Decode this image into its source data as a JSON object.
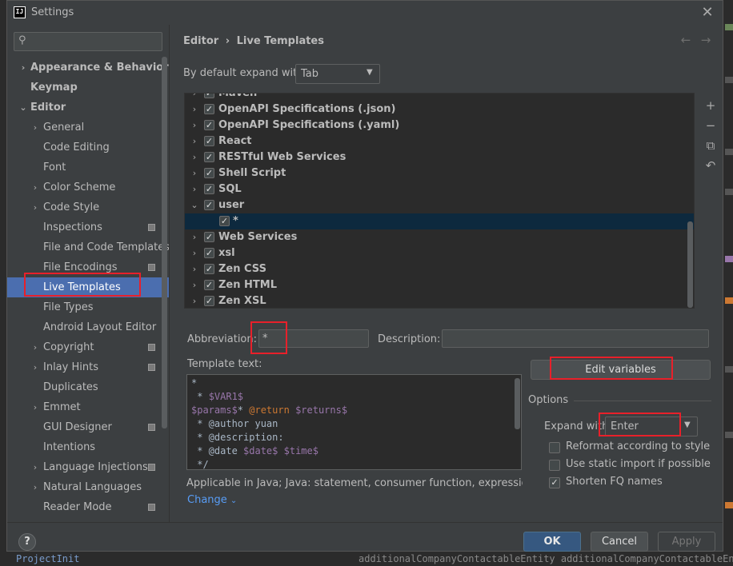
{
  "window": {
    "title": "Settings",
    "logo_text": "IJ"
  },
  "sidebar": {
    "search_placeholder": "",
    "items": [
      {
        "label": "Appearance & Behavior"
      },
      {
        "label": "Keymap"
      },
      {
        "label": "Editor"
      },
      {
        "label": "General"
      },
      {
        "label": "Code Editing"
      },
      {
        "label": "Font"
      },
      {
        "label": "Color Scheme"
      },
      {
        "label": "Code Style"
      },
      {
        "label": "Inspections"
      },
      {
        "label": "File and Code Templates"
      },
      {
        "label": "File Encodings"
      },
      {
        "label": "Live Templates"
      },
      {
        "label": "File Types"
      },
      {
        "label": "Android Layout Editor"
      },
      {
        "label": "Copyright"
      },
      {
        "label": "Inlay Hints"
      },
      {
        "label": "Duplicates"
      },
      {
        "label": "Emmet"
      },
      {
        "label": "GUI Designer"
      },
      {
        "label": "Intentions"
      },
      {
        "label": "Language Injections"
      },
      {
        "label": "Natural Languages"
      },
      {
        "label": "Reader Mode"
      }
    ]
  },
  "breadcrumb": {
    "parent": "Editor",
    "separator": "›",
    "current": "Live Templates"
  },
  "expand": {
    "label": "By default expand with",
    "value": "Tab"
  },
  "template_groups": [
    {
      "label": "Maven"
    },
    {
      "label": "OpenAPI Specifications (.json)"
    },
    {
      "label": "OpenAPI Specifications (.yaml)"
    },
    {
      "label": "React"
    },
    {
      "label": "RESTful Web Services"
    },
    {
      "label": "Shell Script"
    },
    {
      "label": "SQL"
    },
    {
      "label": "user"
    },
    {
      "label": "*"
    },
    {
      "label": "Web Services"
    },
    {
      "label": "xsl"
    },
    {
      "label": "Zen CSS"
    },
    {
      "label": "Zen HTML"
    },
    {
      "label": "Zen XSL"
    }
  ],
  "editor": {
    "abbreviation_label": "Abbreviation:",
    "abbreviation_value": "*",
    "description_label": "Description:",
    "description_value": "",
    "template_text_label": "Template text:",
    "template_lines": [
      "*",
      " * $VAR1$",
      "$params$* @return $returns$",
      " * @author yuan",
      " * @description:",
      " * @date $date$ $time$",
      " */"
    ],
    "applicable": "Applicable in Java; Java: statement, consumer function, expression, de...",
    "change_link": "Change",
    "edit_variables": "Edit variables"
  },
  "options": {
    "label": "Options",
    "expand_with_label": "Expand with",
    "expand_with_value": "Enter",
    "checkboxes": [
      {
        "label": "Reformat according to style",
        "checked": false
      },
      {
        "label": "Use static import if possible",
        "checked": false
      },
      {
        "label": "Shorten FQ names",
        "checked": true
      }
    ]
  },
  "footer": {
    "ok": "OK",
    "cancel": "Cancel",
    "apply": "Apply",
    "help": "?"
  },
  "background": {
    "project_label": "ProjectInit",
    "code_snippet": "additionalCompanyContactableEntity additionalCompanyContactableEnt"
  },
  "colors": {
    "accent": "#4b6eaf",
    "annotation": "#e8202a",
    "link": "#589df6"
  }
}
